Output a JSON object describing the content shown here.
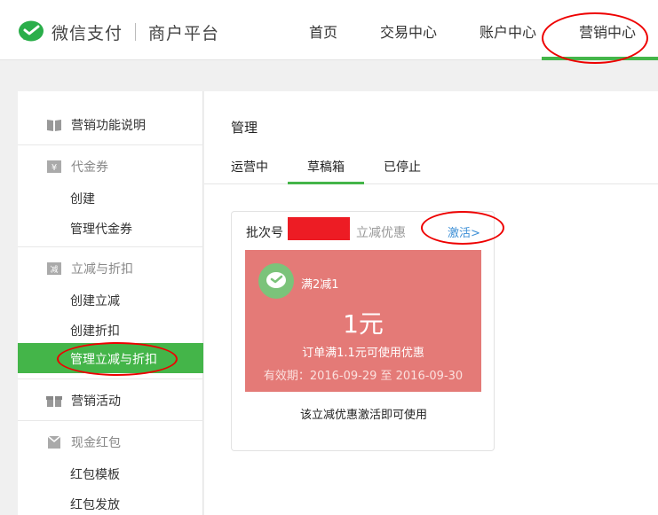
{
  "header": {
    "brand": "微信支付",
    "subbrand": "商户平台",
    "nav": [
      {
        "label": "首页"
      },
      {
        "label": "交易中心"
      },
      {
        "label": "账户中心"
      },
      {
        "label": "营销中心"
      }
    ],
    "accent": "#44b549"
  },
  "sidebar": {
    "intro": "营销功能说明",
    "voucher": {
      "title": "代金券",
      "items": [
        "创建",
        "管理代金券"
      ]
    },
    "discount": {
      "title": "立减与折扣",
      "items": [
        "创建立减",
        "创建折扣",
        "管理立减与折扣"
      ]
    },
    "activity": "营销活动",
    "redpack": {
      "title": "现金红包",
      "items": [
        "红包模板",
        "红包发放"
      ]
    }
  },
  "main": {
    "title": "管理",
    "tabs": [
      "运营中",
      "草稿箱",
      "已停止"
    ],
    "card": {
      "batch_label": "批次号",
      "batch_type": "立减优惠",
      "activate": "激活>",
      "coupon_name": "满2减1",
      "amount": "1元",
      "condition": "订单满1.1元可使用优惠",
      "validity": "有效期：2016-09-29 至 2016-09-30",
      "note": "该立减优惠激活即可使用"
    }
  }
}
